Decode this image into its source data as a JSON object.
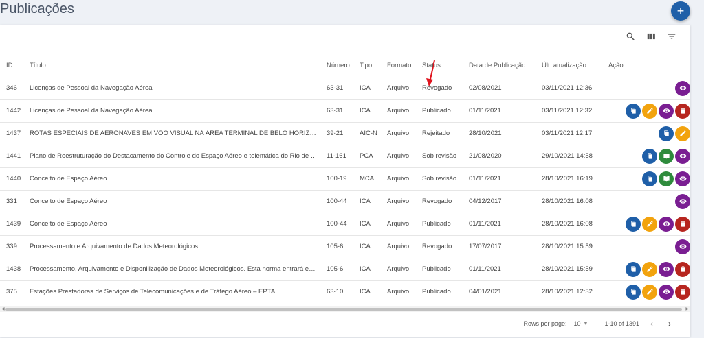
{
  "page": {
    "title": "Publicações",
    "add_icon": "+"
  },
  "toolbar": {
    "icons": [
      "search-icon",
      "columns-icon",
      "filter-icon"
    ]
  },
  "columns": [
    "ID",
    "Título",
    "Número",
    "Tipo",
    "Formato",
    "Status",
    "Data de Publicação",
    "Últ. atualização",
    "Ação"
  ],
  "rows": [
    {
      "id": "346",
      "titulo": "Licenças de Pessoal da Navegação Aérea",
      "numero": "63-31",
      "tipo": "ICA",
      "formato": "Arquivo",
      "status": "Revogado",
      "data": "02/08/2021",
      "atualizacao": "03/11/2021 12:36",
      "acoes": [
        "view"
      ]
    },
    {
      "id": "1442",
      "titulo": "Licenças de Pessoal da Navegação Aérea",
      "numero": "63-31",
      "tipo": "ICA",
      "formato": "Arquivo",
      "status": "Publicado",
      "data": "01/11/2021",
      "atualizacao": "03/11/2021 12:32",
      "acoes": [
        "copy",
        "edit",
        "view",
        "delete"
      ]
    },
    {
      "id": "1437",
      "titulo": "ROTAS ESPECIAIS DE AERONAVES EM VOO VISUAL NA ÁREA TERMINAL DE BELO HORIZONTE",
      "numero": "39-21",
      "tipo": "AIC-N",
      "formato": "Arquivo",
      "status": "Rejeitado",
      "data": "28/10/2021",
      "atualizacao": "03/11/2021 12:17",
      "acoes": [
        "copy",
        "edit"
      ]
    },
    {
      "id": "1441",
      "titulo": "Plano de Reestruturação do Destacamento do Controle do Espaço Aéreo e telemática do Rio de Janeiro",
      "numero": "11-161",
      "tipo": "PCA",
      "formato": "Arquivo",
      "status": "Sob revisão",
      "data": "21/08/2020",
      "atualizacao": "29/10/2021 14:58",
      "acoes": [
        "copy",
        "book",
        "view"
      ]
    },
    {
      "id": "1440",
      "titulo": "Conceito de Espaço Aéreo",
      "numero": "100-19",
      "tipo": "MCA",
      "formato": "Arquivo",
      "status": "Sob revisão",
      "data": "01/11/2021",
      "atualizacao": "28/10/2021 16:19",
      "acoes": [
        "copy",
        "book",
        "view"
      ]
    },
    {
      "id": "331",
      "titulo": "Conceito de Espaço Aéreo",
      "numero": "100-44",
      "tipo": "ICA",
      "formato": "Arquivo",
      "status": "Revogado",
      "data": "04/12/2017",
      "atualizacao": "28/10/2021 16:08",
      "acoes": [
        "view"
      ]
    },
    {
      "id": "1439",
      "titulo": "Conceito de Espaço Aéreo",
      "numero": "100-44",
      "tipo": "ICA",
      "formato": "Arquivo",
      "status": "Publicado",
      "data": "01/11/2021",
      "atualizacao": "28/10/2021 16:08",
      "acoes": [
        "copy",
        "edit",
        "view",
        "delete"
      ]
    },
    {
      "id": "339",
      "titulo": "Processamento e Arquivamento de Dados Meteorológicos",
      "numero": "105-6",
      "tipo": "ICA",
      "formato": "Arquivo",
      "status": "Revogado",
      "data": "17/07/2017",
      "atualizacao": "28/10/2021 15:59",
      "acoes": [
        "view"
      ]
    },
    {
      "id": "1438",
      "titulo": "Processamento, Arquivamento e Disponilização de Dados Meteorológicos. Esta norma entrará  em vigor",
      "numero": "105-6",
      "tipo": "ICA",
      "formato": "Arquivo",
      "status": "Publicado",
      "data": "01/11/2021",
      "atualizacao": "28/10/2021 15:59",
      "acoes": [
        "copy",
        "edit",
        "view",
        "delete"
      ]
    },
    {
      "id": "375",
      "titulo": "Estações Prestadoras de Serviços de Telecomunicações e de Tráfego Aéreo – EPTA",
      "numero": "63-10",
      "tipo": "ICA",
      "formato": "Arquivo",
      "status": "Publicado",
      "data": "04/01/2021",
      "atualizacao": "28/10/2021 12:32",
      "acoes": [
        "copy",
        "edit",
        "view",
        "delete"
      ]
    }
  ],
  "footer": {
    "rows_per_page_label": "Rows per page:",
    "rows_per_page_value": "10",
    "range": "1-10 of 1391",
    "prev_icon": "‹",
    "next_icon": "›"
  },
  "colors": {
    "copy": "#1f5fa8",
    "edit": "#f2a30e",
    "view": "#7a1e92",
    "delete": "#b7261f",
    "book": "#2e8b3c",
    "annotation_arrow": "#e0141e"
  }
}
